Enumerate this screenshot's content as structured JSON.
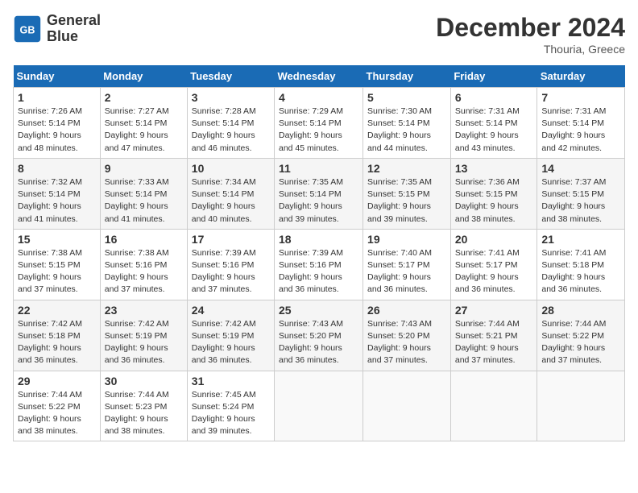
{
  "header": {
    "logo_line1": "General",
    "logo_line2": "Blue",
    "month": "December 2024",
    "location": "Thouria, Greece"
  },
  "days_of_week": [
    "Sunday",
    "Monday",
    "Tuesday",
    "Wednesday",
    "Thursday",
    "Friday",
    "Saturday"
  ],
  "weeks": [
    [
      {
        "day": 1,
        "info": "Sunrise: 7:26 AM\nSunset: 5:14 PM\nDaylight: 9 hours\nand 48 minutes."
      },
      {
        "day": 2,
        "info": "Sunrise: 7:27 AM\nSunset: 5:14 PM\nDaylight: 9 hours\nand 47 minutes."
      },
      {
        "day": 3,
        "info": "Sunrise: 7:28 AM\nSunset: 5:14 PM\nDaylight: 9 hours\nand 46 minutes."
      },
      {
        "day": 4,
        "info": "Sunrise: 7:29 AM\nSunset: 5:14 PM\nDaylight: 9 hours\nand 45 minutes."
      },
      {
        "day": 5,
        "info": "Sunrise: 7:30 AM\nSunset: 5:14 PM\nDaylight: 9 hours\nand 44 minutes."
      },
      {
        "day": 6,
        "info": "Sunrise: 7:31 AM\nSunset: 5:14 PM\nDaylight: 9 hours\nand 43 minutes."
      },
      {
        "day": 7,
        "info": "Sunrise: 7:31 AM\nSunset: 5:14 PM\nDaylight: 9 hours\nand 42 minutes."
      }
    ],
    [
      {
        "day": 8,
        "info": "Sunrise: 7:32 AM\nSunset: 5:14 PM\nDaylight: 9 hours\nand 41 minutes."
      },
      {
        "day": 9,
        "info": "Sunrise: 7:33 AM\nSunset: 5:14 PM\nDaylight: 9 hours\nand 41 minutes."
      },
      {
        "day": 10,
        "info": "Sunrise: 7:34 AM\nSunset: 5:14 PM\nDaylight: 9 hours\nand 40 minutes."
      },
      {
        "day": 11,
        "info": "Sunrise: 7:35 AM\nSunset: 5:14 PM\nDaylight: 9 hours\nand 39 minutes."
      },
      {
        "day": 12,
        "info": "Sunrise: 7:35 AM\nSunset: 5:15 PM\nDaylight: 9 hours\nand 39 minutes."
      },
      {
        "day": 13,
        "info": "Sunrise: 7:36 AM\nSunset: 5:15 PM\nDaylight: 9 hours\nand 38 minutes."
      },
      {
        "day": 14,
        "info": "Sunrise: 7:37 AM\nSunset: 5:15 PM\nDaylight: 9 hours\nand 38 minutes."
      }
    ],
    [
      {
        "day": 15,
        "info": "Sunrise: 7:38 AM\nSunset: 5:15 PM\nDaylight: 9 hours\nand 37 minutes."
      },
      {
        "day": 16,
        "info": "Sunrise: 7:38 AM\nSunset: 5:16 PM\nDaylight: 9 hours\nand 37 minutes."
      },
      {
        "day": 17,
        "info": "Sunrise: 7:39 AM\nSunset: 5:16 PM\nDaylight: 9 hours\nand 37 minutes."
      },
      {
        "day": 18,
        "info": "Sunrise: 7:39 AM\nSunset: 5:16 PM\nDaylight: 9 hours\nand 36 minutes."
      },
      {
        "day": 19,
        "info": "Sunrise: 7:40 AM\nSunset: 5:17 PM\nDaylight: 9 hours\nand 36 minutes."
      },
      {
        "day": 20,
        "info": "Sunrise: 7:41 AM\nSunset: 5:17 PM\nDaylight: 9 hours\nand 36 minutes."
      },
      {
        "day": 21,
        "info": "Sunrise: 7:41 AM\nSunset: 5:18 PM\nDaylight: 9 hours\nand 36 minutes."
      }
    ],
    [
      {
        "day": 22,
        "info": "Sunrise: 7:42 AM\nSunset: 5:18 PM\nDaylight: 9 hours\nand 36 minutes."
      },
      {
        "day": 23,
        "info": "Sunrise: 7:42 AM\nSunset: 5:19 PM\nDaylight: 9 hours\nand 36 minutes."
      },
      {
        "day": 24,
        "info": "Sunrise: 7:42 AM\nSunset: 5:19 PM\nDaylight: 9 hours\nand 36 minutes."
      },
      {
        "day": 25,
        "info": "Sunrise: 7:43 AM\nSunset: 5:20 PM\nDaylight: 9 hours\nand 36 minutes."
      },
      {
        "day": 26,
        "info": "Sunrise: 7:43 AM\nSunset: 5:20 PM\nDaylight: 9 hours\nand 37 minutes."
      },
      {
        "day": 27,
        "info": "Sunrise: 7:44 AM\nSunset: 5:21 PM\nDaylight: 9 hours\nand 37 minutes."
      },
      {
        "day": 28,
        "info": "Sunrise: 7:44 AM\nSunset: 5:22 PM\nDaylight: 9 hours\nand 37 minutes."
      }
    ],
    [
      {
        "day": 29,
        "info": "Sunrise: 7:44 AM\nSunset: 5:22 PM\nDaylight: 9 hours\nand 38 minutes."
      },
      {
        "day": 30,
        "info": "Sunrise: 7:44 AM\nSunset: 5:23 PM\nDaylight: 9 hours\nand 38 minutes."
      },
      {
        "day": 31,
        "info": "Sunrise: 7:45 AM\nSunset: 5:24 PM\nDaylight: 9 hours\nand 39 minutes."
      },
      null,
      null,
      null,
      null
    ]
  ]
}
